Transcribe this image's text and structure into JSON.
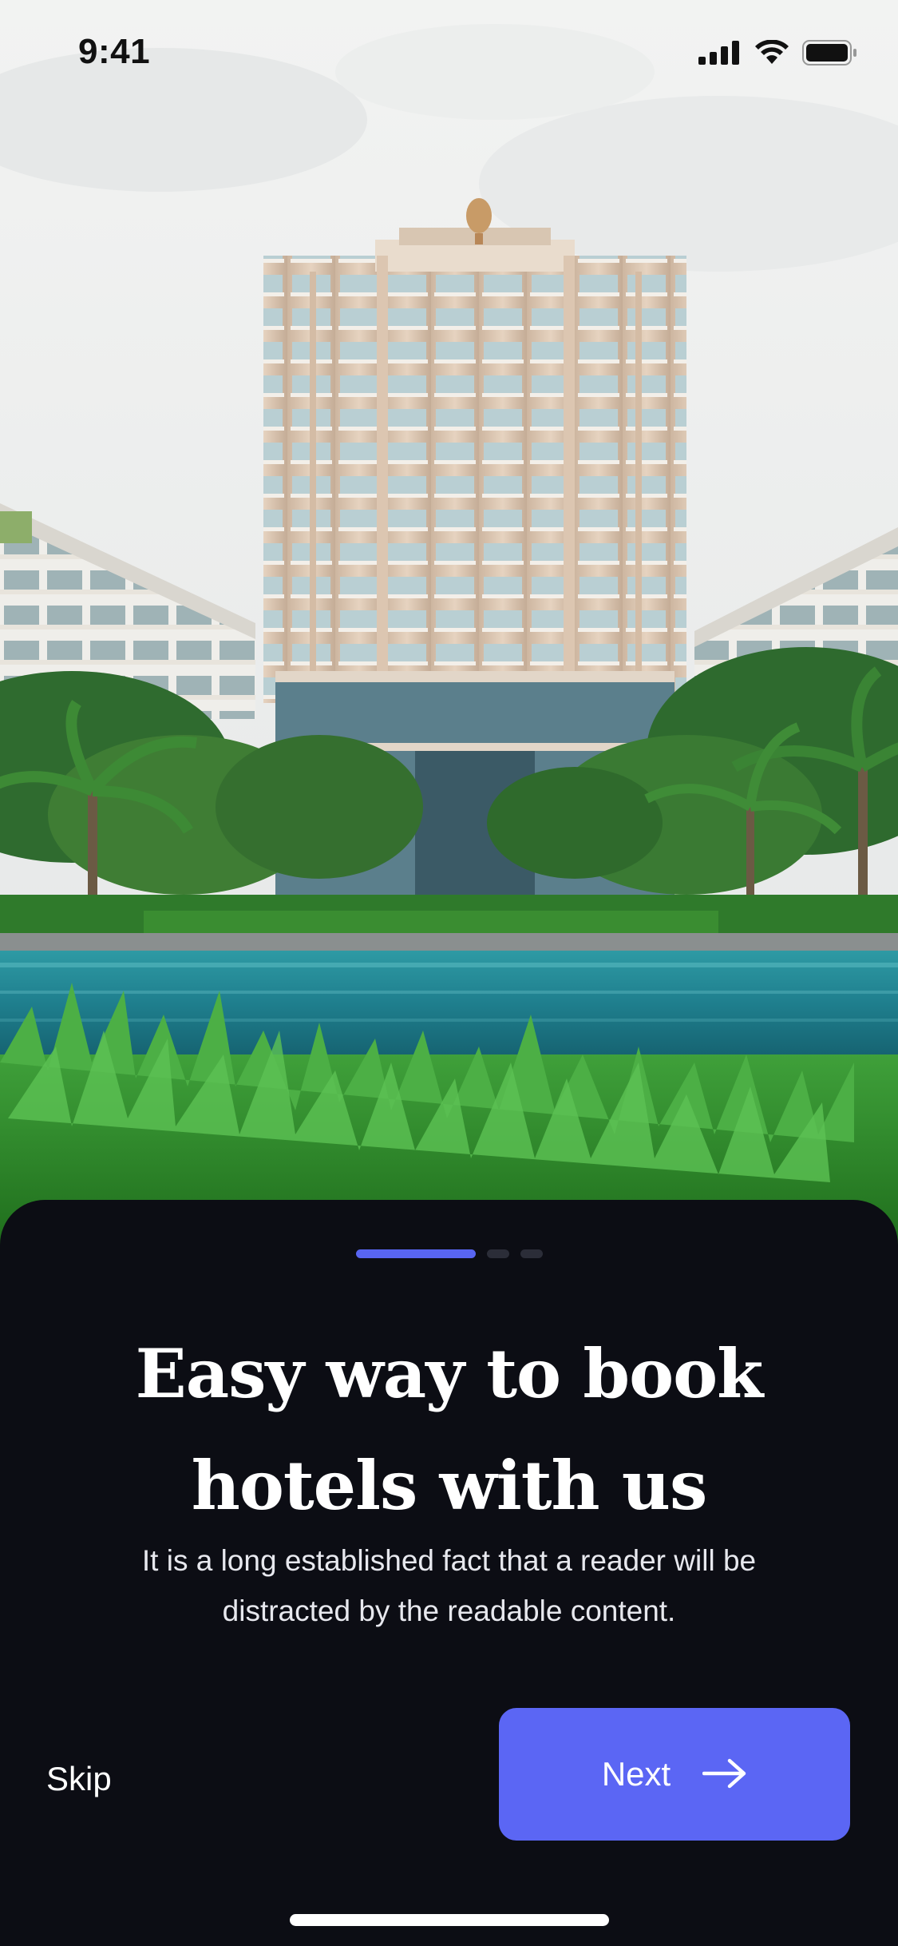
{
  "status_bar": {
    "time": "9:41",
    "icons": [
      "cellular-signal-icon",
      "wifi-icon",
      "battery-icon"
    ]
  },
  "hero": {
    "image": "hotel-photo",
    "content": "tall hotel tower with palm trees, pool and green plants"
  },
  "onboarding": {
    "pager": {
      "count": 3,
      "active_index": 0,
      "active_color": "#5865f2"
    },
    "title_lines": [
      "Easy way to book",
      "hotels with us"
    ],
    "subtitle_lines": [
      "It is a long established fact that a reader will be",
      "distracted by the readable content."
    ],
    "skip_label": "Skip",
    "next_label": "Next",
    "next_icon": "arrow-right-icon"
  },
  "colors": {
    "background": "#0c0d14",
    "accent": "#5b66f4",
    "text": "#ffffff"
  }
}
